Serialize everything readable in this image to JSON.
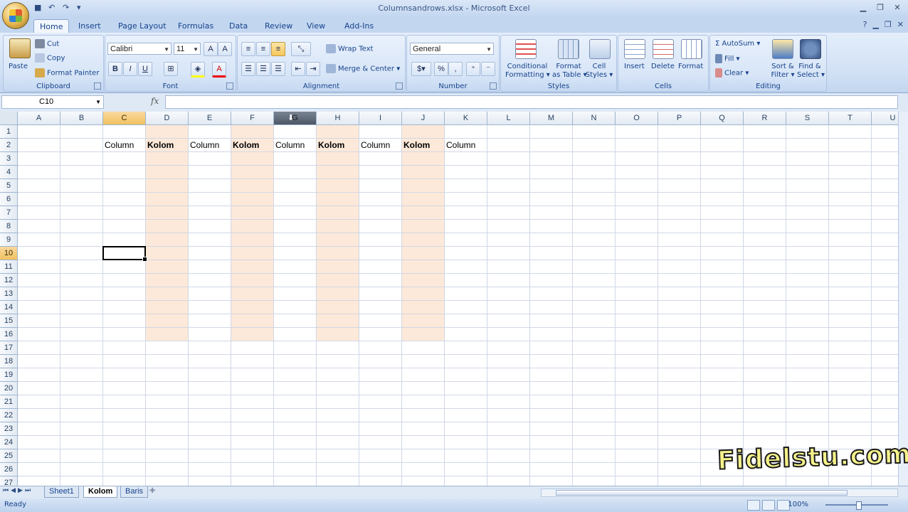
{
  "window": {
    "title": "Columnsandrows.xlsx - Microsoft Excel",
    "controls": [
      "minimize",
      "restore",
      "close"
    ]
  },
  "ribbon": {
    "tabs": [
      "Home",
      "Insert",
      "Page Layout",
      "Formulas",
      "Data",
      "Review",
      "View",
      "Add-Ins"
    ],
    "active_tab": "Home",
    "clipboard": {
      "paste": "Paste",
      "cut": "Cut",
      "copy": "Copy",
      "format_painter": "Format Painter",
      "label": "Clipboard"
    },
    "font": {
      "name": "Calibri",
      "size": "11",
      "label": "Font"
    },
    "alignment": {
      "wrap_text": "Wrap Text",
      "merge_center": "Merge & Center",
      "label": "Alignment"
    },
    "number": {
      "format": "General",
      "label": "Number"
    },
    "styles": {
      "conditional": "Conditional",
      "conditional2": "Formatting",
      "format_as": "Format",
      "format_as2": "as Table",
      "cell": "Cell",
      "cell2": "Styles",
      "label": "Styles"
    },
    "cells": {
      "insert": "Insert",
      "delete": "Delete",
      "format": "Format",
      "label": "Cells"
    },
    "editing": {
      "autosum": "AutoSum",
      "fill": "Fill",
      "clear": "Clear",
      "sort": "Sort &",
      "sort2": "Filter",
      "find": "Find &",
      "find2": "Select",
      "label": "Editing"
    }
  },
  "formula_bar": {
    "name_box": "C10",
    "formula": ""
  },
  "grid": {
    "columns": [
      "A",
      "B",
      "C",
      "D",
      "E",
      "F",
      "G",
      "H",
      "I",
      "J",
      "K",
      "L",
      "M",
      "N",
      "O",
      "P",
      "Q",
      "R",
      "S",
      "T",
      "U"
    ],
    "rows": [
      "1",
      "2",
      "3",
      "4",
      "5",
      "6",
      "7",
      "8",
      "9",
      "10",
      "11",
      "12",
      "13",
      "14",
      "15",
      "16",
      "17",
      "18",
      "19",
      "20",
      "21",
      "22",
      "23",
      "24",
      "25",
      "26",
      "27"
    ],
    "selected_column": "C",
    "selected_row": "10",
    "row2_cells": {
      "C": "Column",
      "D": "Kolom",
      "E": "Column",
      "F": "Kolom",
      "G": "Column",
      "H": "Kolom",
      "I": "Column",
      "J": "Kolom",
      "K": "Column"
    },
    "shaded_columns": [
      "D",
      "F",
      "H",
      "J"
    ],
    "shade_color": "#fde9d9"
  },
  "sheets": {
    "tabs": [
      "Sheet1",
      "Kolom",
      "Baris"
    ],
    "active": "Kolom"
  },
  "status": {
    "text": "Ready",
    "zoom": "100%"
  },
  "watermark": "Fidelstu.com"
}
